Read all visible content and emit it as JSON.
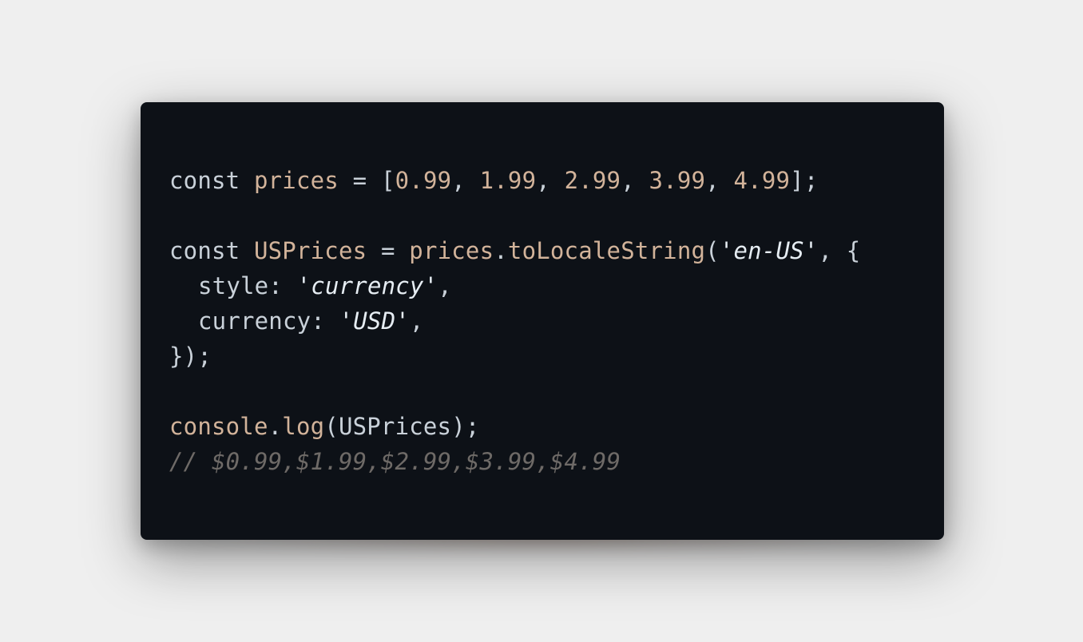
{
  "code": {
    "line1": {
      "kw": "const",
      "var": "prices",
      "eq": "=",
      "open": "[",
      "nums": [
        "0.99",
        "1.99",
        "2.99",
        "3.99",
        "4.99"
      ],
      "sep": ", ",
      "close": "];"
    },
    "line3": {
      "kw": "const",
      "var": "USPrices",
      "eq": "=",
      "obj": "prices",
      "dot": ".",
      "method": "toLocaleString",
      "paren_open": "(",
      "arg1": "'en-US'",
      "after_arg": ", {"
    },
    "line4": {
      "key": "style:",
      "value": "'currency'",
      "trail": ","
    },
    "line5": {
      "key": "currency:",
      "value": "'USD'",
      "trail": ","
    },
    "line6": {
      "text": "});"
    },
    "line8": {
      "obj": "console",
      "dot": ".",
      "method": "log",
      "args": "(USPrices);"
    },
    "line9": {
      "comment": "// $0.99,$1.99,$2.99,$3.99,$4.99"
    }
  }
}
